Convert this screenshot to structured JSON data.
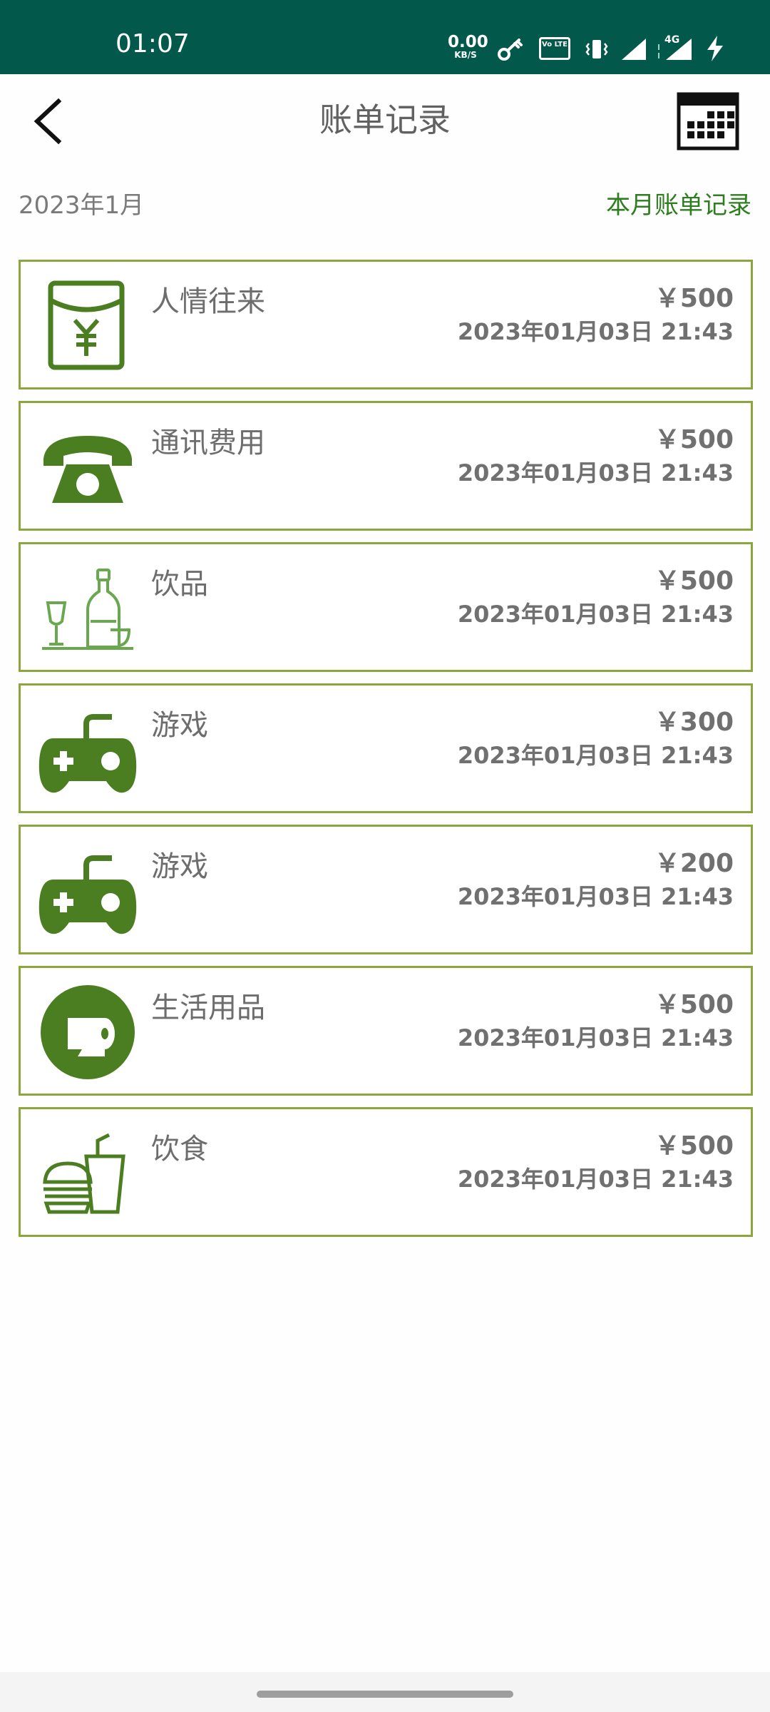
{
  "status_bar": {
    "time": "01:07",
    "net_speed_value": "0.00",
    "net_speed_unit": "KB/S",
    "volte_label": "Vo LTE",
    "network_type": "4G"
  },
  "header": {
    "title": "账单记录",
    "back_icon": "chevron-left-icon",
    "calendar_icon": "calendar-icon"
  },
  "month": {
    "label": "2023年1月",
    "link": "本月账单记录"
  },
  "bills": [
    {
      "name": "人情往来",
      "amount": "￥500",
      "time": "2023年01月03日 21:43",
      "icon": "red-envelope-icon"
    },
    {
      "name": "通讯费用",
      "amount": "￥500",
      "time": "2023年01月03日 21:43",
      "icon": "telephone-icon"
    },
    {
      "name": "饮品",
      "amount": "￥500",
      "time": "2023年01月03日 21:43",
      "icon": "drinks-icon"
    },
    {
      "name": "游戏",
      "amount": "￥300",
      "time": "2023年01月03日 21:43",
      "icon": "gamepad-icon"
    },
    {
      "name": "游戏",
      "amount": "￥200",
      "time": "2023年01月03日 21:43",
      "icon": "gamepad-icon"
    },
    {
      "name": "生活用品",
      "amount": "￥500",
      "time": "2023年01月03日 21:43",
      "icon": "toilet-paper-icon"
    },
    {
      "name": "饮食",
      "amount": "￥500",
      "time": "2023年01月03日 21:43",
      "icon": "fast-food-icon"
    }
  ],
  "colors": {
    "status_bar": "#02584b",
    "accent_green": "#2e7d1e",
    "icon_green": "#4b7d21",
    "card_border": "#8aa63c"
  }
}
